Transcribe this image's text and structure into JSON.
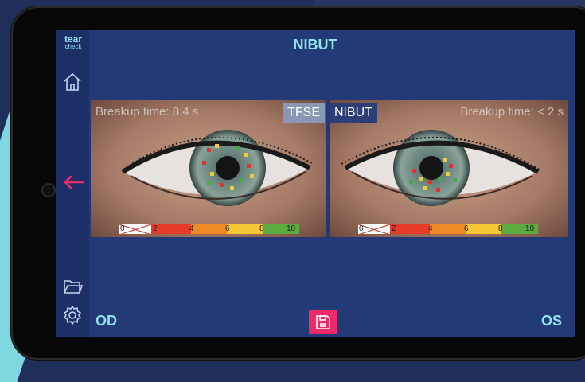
{
  "header": {
    "title": "NIBUT"
  },
  "logo": {
    "line1": "tear",
    "line2": "check"
  },
  "sidebar": {
    "home_icon": "home-icon",
    "back_icon": "arrow-left-icon",
    "folder_icon": "folder-icon",
    "settings_icon": "gear-icon"
  },
  "left_panel": {
    "breakup_label": "Breakup time: 8.4 s",
    "mode_tag": "TFSE",
    "eye_label": "OD",
    "scale_ticks": [
      "0",
      "2",
      "4",
      "6",
      "8",
      "10"
    ]
  },
  "right_panel": {
    "breakup_label": "Breakup time: < 2 s",
    "mode_tag": "NIBUT",
    "eye_label": "OS",
    "scale_ticks": [
      "0",
      "2",
      "4",
      "6",
      "8",
      "10"
    ]
  },
  "save_button": {
    "icon": "save-icon"
  },
  "colors": {
    "accent": "#8fe3ea",
    "save_button": "#ee2b68",
    "back_arrow": "#ee2b68",
    "screen_bg": "#233a77",
    "sidebar_bg": "#1c2f66"
  }
}
